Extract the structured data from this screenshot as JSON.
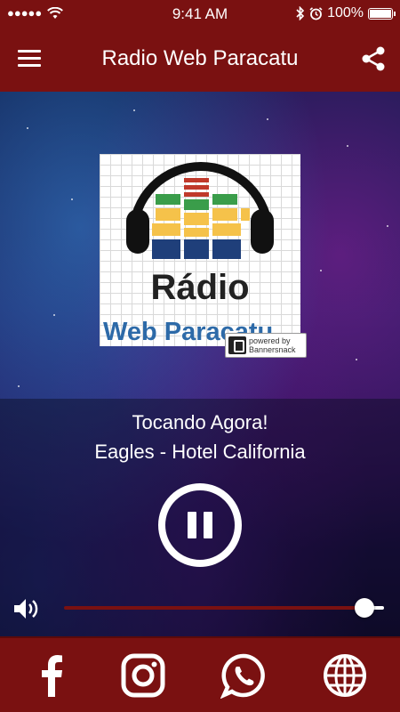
{
  "status_bar": {
    "signal": "●●●●●",
    "time": "9:41 AM",
    "battery": "100%"
  },
  "app_bar": {
    "title": "Radio Web Paracatu",
    "menu_icon": "hamburger-menu-icon",
    "share_icon": "share-icon"
  },
  "logo": {
    "word_top": "Rádio",
    "word_bottom": "Web Paracatu",
    "badge_line1": "powered by",
    "badge_line2": "Bannersnack"
  },
  "player": {
    "now_label": "Tocando Agora!",
    "track": "Eagles - Hotel California",
    "state": "playing",
    "pause_icon": "pause-icon",
    "volume_icon": "speaker-icon",
    "volume_level": 0.94
  },
  "social_bar": {
    "items": [
      {
        "icon": "facebook-icon"
      },
      {
        "icon": "instagram-icon"
      },
      {
        "icon": "whatsapp-icon"
      },
      {
        "icon": "globe-icon"
      }
    ]
  },
  "colors": {
    "primary": "#7a1111",
    "text": "#ffffff"
  }
}
